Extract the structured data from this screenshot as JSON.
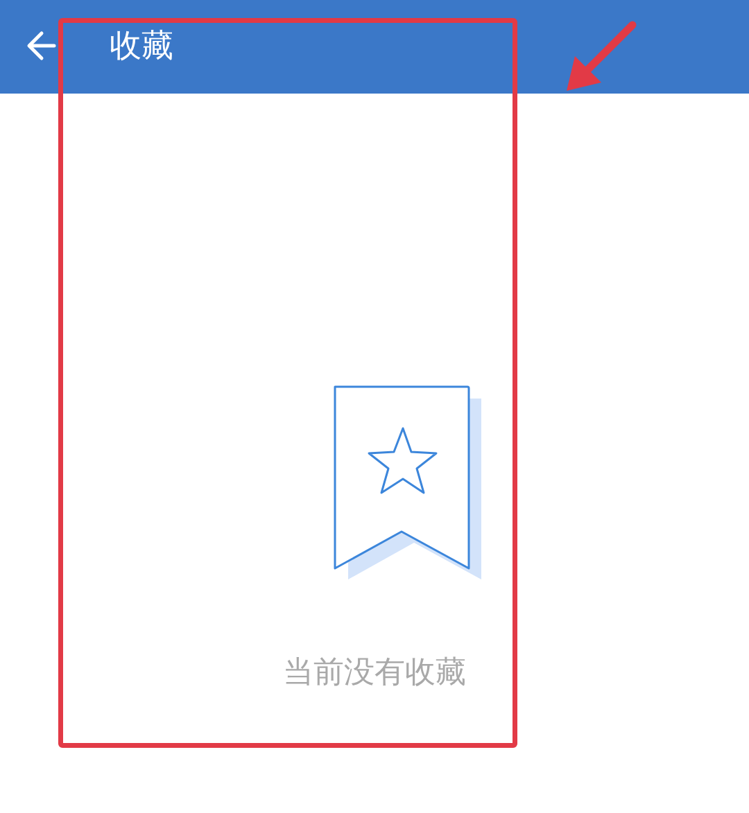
{
  "header": {
    "title": "收藏"
  },
  "empty_state": {
    "message": "当前没有收藏"
  }
}
